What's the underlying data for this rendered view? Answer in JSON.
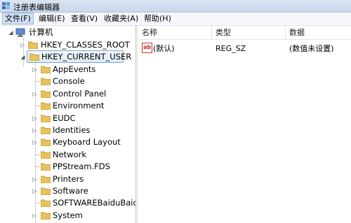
{
  "window": {
    "title": "注册表编辑器"
  },
  "menu": [
    {
      "label": "文件(F)"
    },
    {
      "label": "编辑(E)"
    },
    {
      "label": "查看(V)"
    },
    {
      "label": "收藏夹(A)"
    },
    {
      "label": "帮助(H)"
    }
  ],
  "tree": {
    "root": "计算机",
    "hives": {
      "classes_root": "HKEY_CLASSES_ROOT",
      "current_user": "HKEY_CURRENT_USER"
    },
    "children": [
      "AppEvents",
      "Console",
      "Control Panel",
      "Environment",
      "EUDC",
      "Identities",
      "Keyboard Layout",
      "Network",
      "PPStream.FDS",
      "Printers",
      "Software",
      "SOFTWAREBaiduBaidu",
      "System"
    ]
  },
  "list": {
    "columns": {
      "name": "名称",
      "type": "类型",
      "data": "数据"
    },
    "rows": [
      {
        "name": "(默认)",
        "type": "REG_SZ",
        "data": "(数值未设置)",
        "icon": "string-value-icon"
      }
    ]
  },
  "colors": {
    "folder": "#e8c25a",
    "selection_border": "#7da2ce",
    "titlebar": "#d9e4f1"
  }
}
